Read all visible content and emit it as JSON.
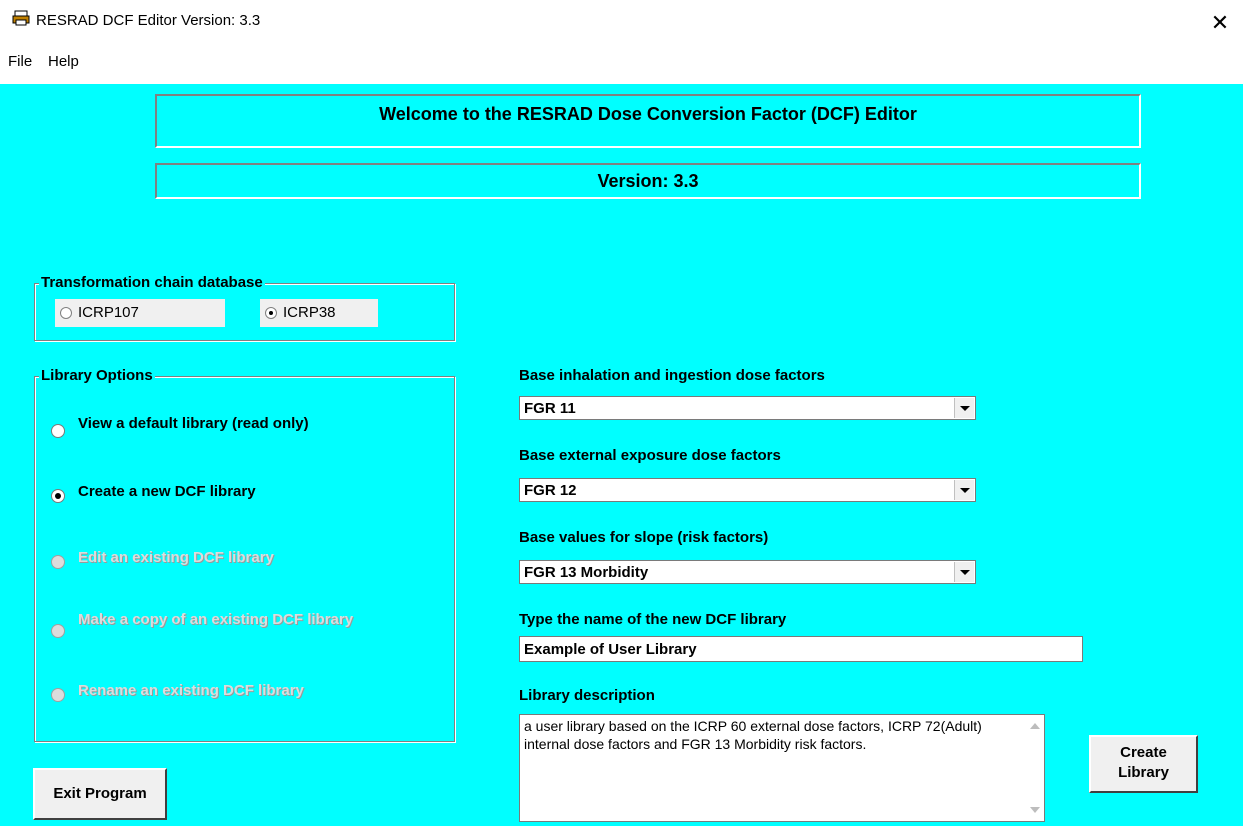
{
  "window": {
    "title": "RESRAD DCF Editor Version: 3.3",
    "close_glyph": "✕"
  },
  "menu": {
    "items": [
      "File",
      "Help"
    ]
  },
  "banner": {
    "welcome": "Welcome to the RESRAD Dose Conversion Factor (DCF) Editor",
    "version": "Version: 3.3"
  },
  "transformation": {
    "legend": "Transformation chain database",
    "options": [
      "ICRP107",
      "ICRP38"
    ],
    "selected": "ICRP38"
  },
  "library_options": {
    "legend": "Library Options",
    "items": [
      {
        "label": "View a default library (read only)",
        "enabled": true,
        "selected": false
      },
      {
        "label": "Create a new DCF library",
        "enabled": true,
        "selected": true
      },
      {
        "label": "Edit an existing DCF library",
        "enabled": false,
        "selected": false
      },
      {
        "label": "Make a copy of an existing DCF library",
        "enabled": false,
        "selected": false
      },
      {
        "label": "Rename an existing DCF library",
        "enabled": false,
        "selected": false
      }
    ]
  },
  "fields": {
    "inhalation_label": "Base inhalation and ingestion dose factors",
    "inhalation_value": "FGR 11",
    "external_label": "Base external exposure dose factors",
    "external_value": "FGR 12",
    "slope_label": "Base values for slope (risk factors)",
    "slope_value": "FGR 13 Morbidity",
    "name_label": "Type the name of the new DCF library",
    "name_value": "Example of User Library",
    "description_label": "Library description",
    "description_value": "a user library based on the ICRP 60 external dose factors, ICRP 72(Adult) internal dose factors and FGR 13 Morbidity risk factors."
  },
  "buttons": {
    "exit": "Exit Program",
    "create": "Create Library"
  },
  "colors": {
    "background": "#00ffff",
    "disabled_text": "#dcdcdc"
  },
  "icons": {
    "app": "printer-icon",
    "close": "close-icon",
    "dropdown": "chevron-down-icon"
  }
}
